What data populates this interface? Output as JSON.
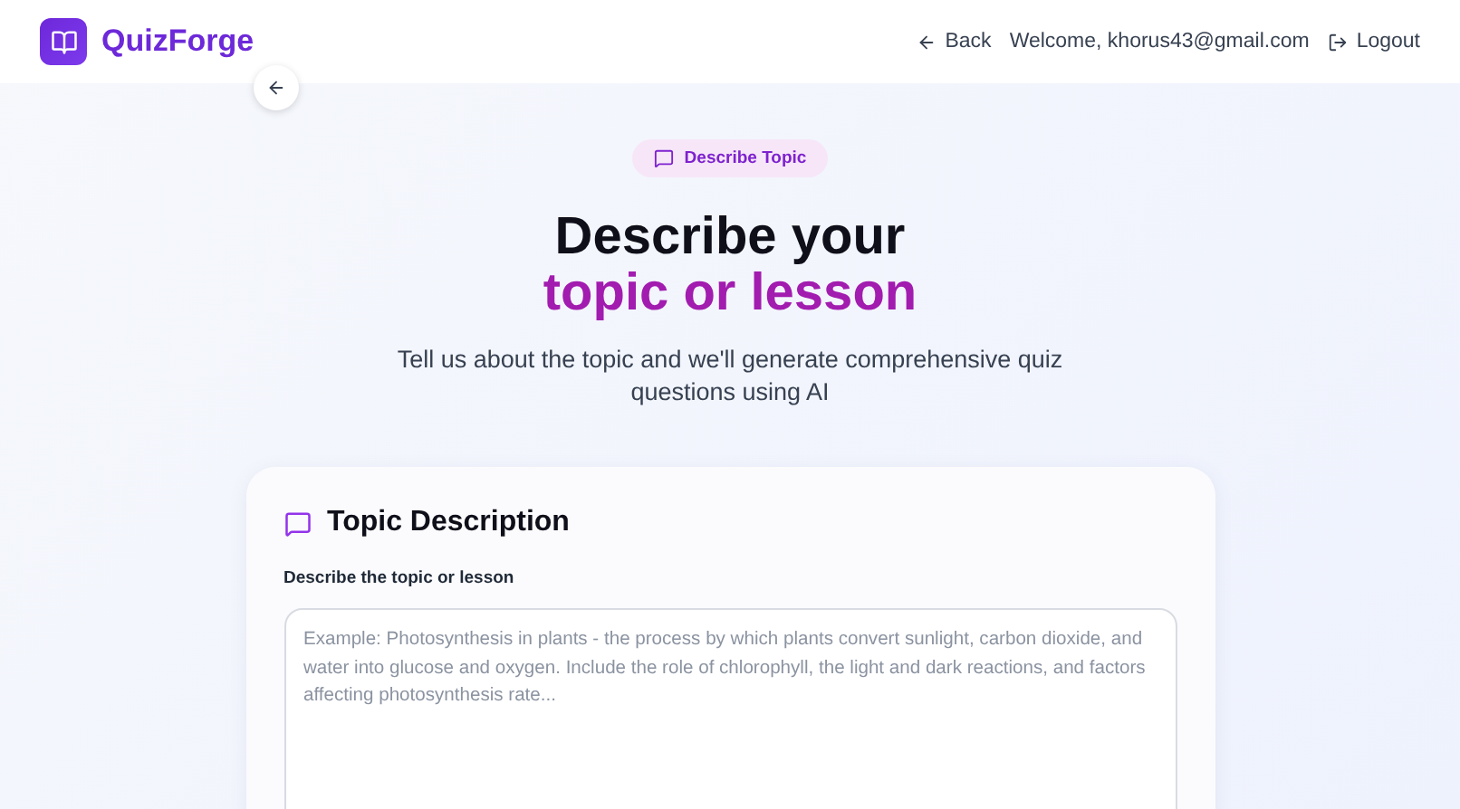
{
  "header": {
    "brand": "QuizForge",
    "back": "Back",
    "welcome": "Welcome, khorus43@gmail.com",
    "logout": "Logout"
  },
  "hero": {
    "badge": "Describe Topic",
    "title_line_1": "Describe your",
    "title_line_2": "topic or lesson",
    "subtitle": "Tell us about the topic and we'll generate comprehensive quiz questions using AI"
  },
  "card": {
    "title": "Topic Description",
    "field_label": "Describe the topic or lesson",
    "placeholder": "Example: Photosynthesis in plants - the process by which plants convert sunlight, carbon dioxide, and water into glucose and oxygen. Include the role of chlorophyll, the light and dark reactions, and factors affecting photosynthesis rate..."
  }
}
